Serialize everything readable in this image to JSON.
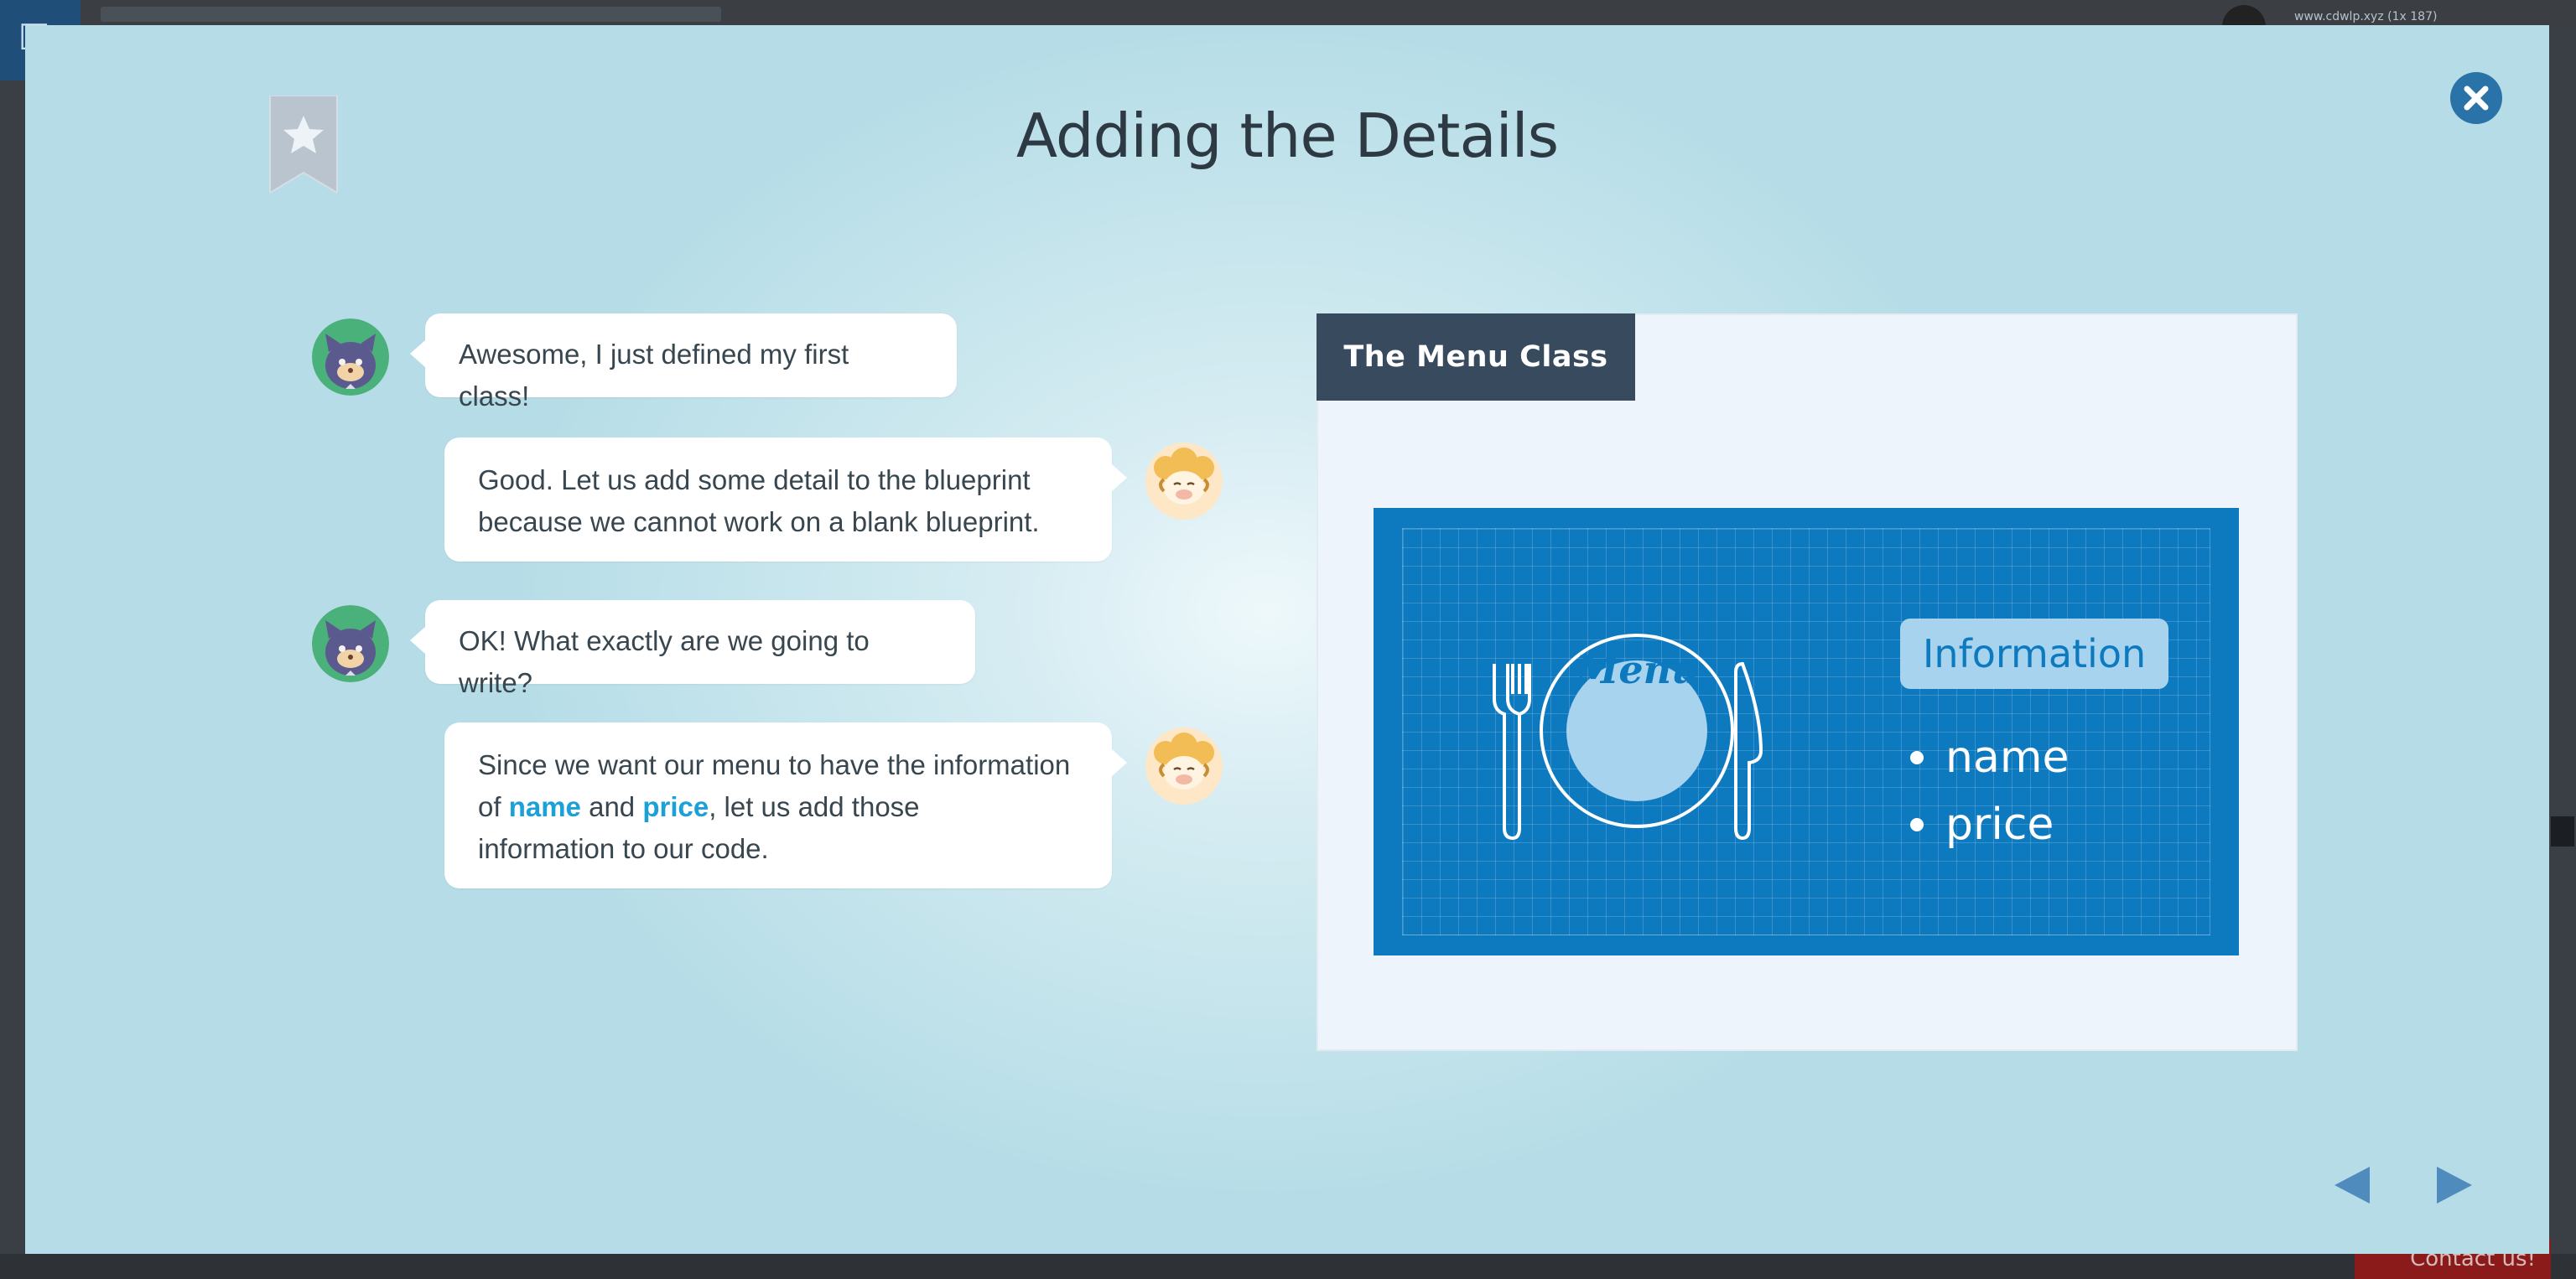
{
  "background": {
    "username": "www.cdwlp.xyz (1x 187)",
    "contact_label": "Contact us!"
  },
  "modal": {
    "title": "Adding the Details",
    "bookmark_icon": "star-bookmark",
    "close_icon": "close-x"
  },
  "chat": [
    {
      "speaker": "cat",
      "side": "left",
      "text": "Awesome, I just defined my first class!"
    },
    {
      "speaker": "sheep",
      "side": "right",
      "line1": "Good. Let us add some detail to the blueprint",
      "line2": "because we cannot work on a blank blueprint."
    },
    {
      "speaker": "cat",
      "side": "left",
      "text": "OK! What exactly are we going to write?"
    },
    {
      "speaker": "sheep",
      "side": "right",
      "line1": "Since we want our menu to have the information",
      "line2_prefix": "of ",
      "kw1": "name",
      "mid": " and ",
      "kw2": "price",
      "line2_suffix": ", let us add those",
      "line3": "information to our code."
    }
  ],
  "panel": {
    "tab_label": "The Menu Class",
    "illustration": {
      "plate_label": "Menu",
      "info_title": "Information",
      "items": [
        "name",
        "price"
      ]
    }
  },
  "nav": {
    "prev_icon": "triangle-left",
    "next_icon": "triangle-right"
  },
  "colors": {
    "accent": "#1ba0d8",
    "blueprint": "#0d79bf",
    "tab": "#374a5e",
    "close": "#2a73a8",
    "nav_arrow": "#4f8cbd"
  }
}
